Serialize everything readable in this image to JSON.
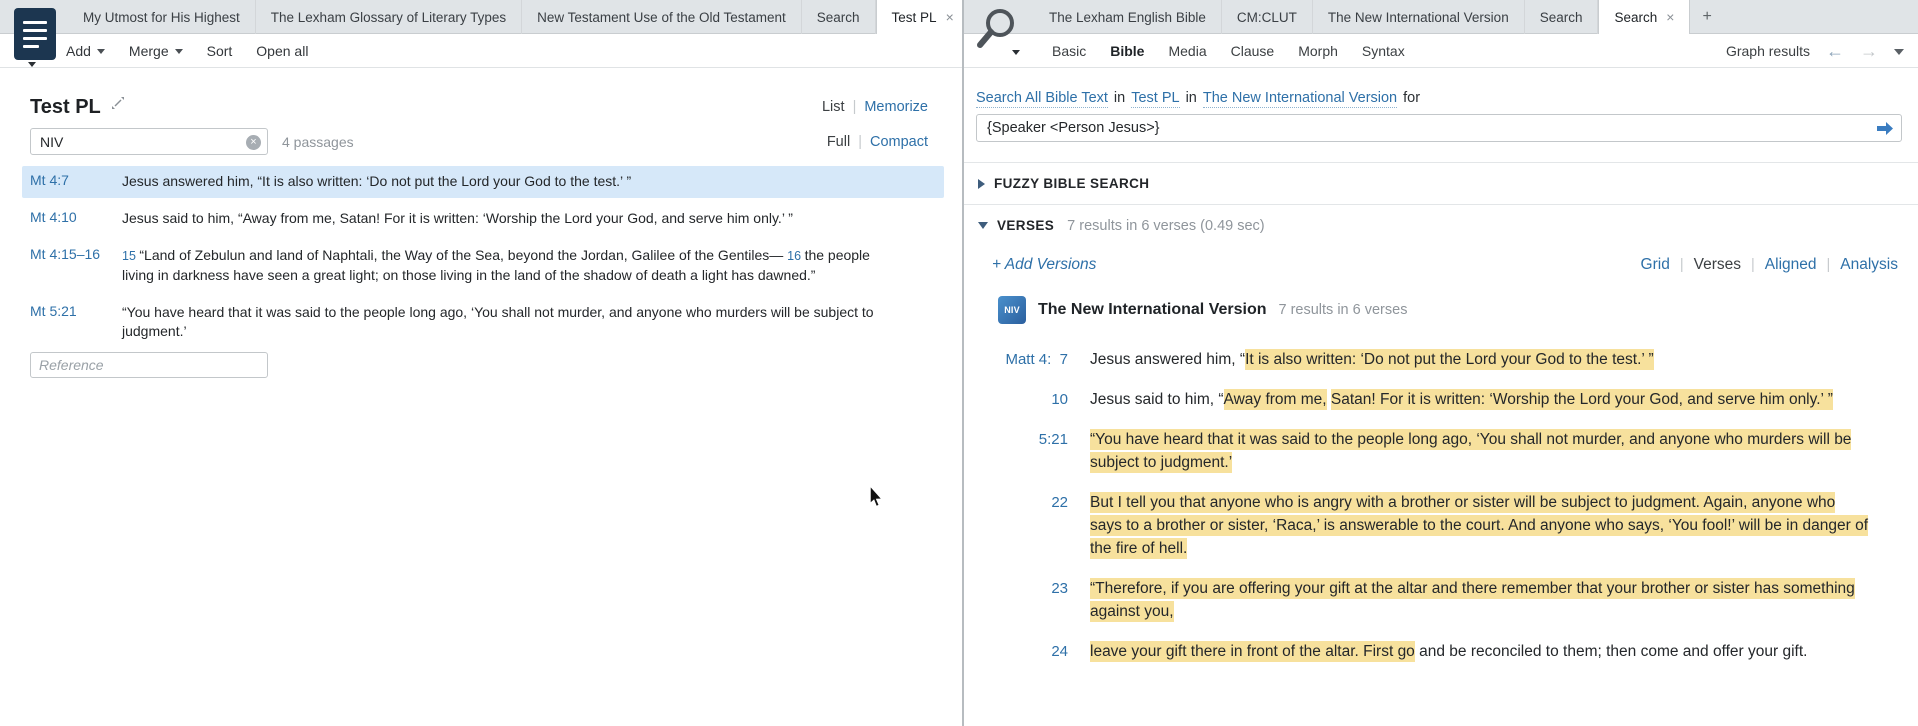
{
  "left": {
    "tabs": [
      {
        "label": "My Utmost for His Highest"
      },
      {
        "label": "The Lexham Glossary of Literary Types"
      },
      {
        "label": "New Testament Use of the Old Testament"
      },
      {
        "label": "Search"
      },
      {
        "label": "Test PL",
        "active": true,
        "closable": true
      },
      {
        "label": "+",
        "add": true
      }
    ],
    "toolbar": [
      {
        "label": "Add",
        "caret": true
      },
      {
        "label": "Merge",
        "caret": true
      },
      {
        "label": "Sort"
      },
      {
        "label": "Open all"
      }
    ],
    "title": "Test PL",
    "view_toggle": [
      {
        "label": "List",
        "active": true
      },
      {
        "label": "Memorize"
      }
    ],
    "filter_value": "NIV",
    "passage_count": "4 passages",
    "density_toggle": [
      {
        "label": "Full",
        "active": true
      },
      {
        "label": "Compact"
      }
    ],
    "passages": [
      {
        "ref": "Mt 4:7",
        "selected": true,
        "segments": [
          {
            "text": "Jesus answered him, “It is also written: ‘Do not put the Lord your God to the test.’ ”"
          }
        ]
      },
      {
        "ref": "Mt 4:10",
        "segments": [
          {
            "text": "Jesus said to him, “Away from me, Satan! For it is written: ‘Worship the Lord your God, and serve him only.’ ”"
          }
        ]
      },
      {
        "ref": "Mt 4:15–16",
        "segments": [
          {
            "verse_num": "15"
          },
          {
            "text": "“Land of Zebulun and land of Naphtali, the Way of the Sea, beyond the Jordan, Galilee of the Gentiles— "
          },
          {
            "verse_num": "16"
          },
          {
            "text": "the people living in darkness have seen a great light; on those living in the land of the shadow of death a light has dawned.”"
          }
        ]
      },
      {
        "ref": "Mt 5:21",
        "segments": [
          {
            "text": "“You have heard that it was said to the people long ago, ‘You shall not murder, and anyone who murders will be subject to judgment.’"
          }
        ]
      }
    ],
    "reference_placeholder": "Reference"
  },
  "right": {
    "tabs": [
      {
        "label": "The Lexham English Bible"
      },
      {
        "label": "CM:CLUT"
      },
      {
        "label": "The New International Version"
      },
      {
        "label": "Search"
      },
      {
        "label": "Search",
        "active": true,
        "closable": true
      },
      {
        "label": "+",
        "add": true
      }
    ],
    "search_kinds": [
      {
        "label": "Basic"
      },
      {
        "label": "Bible",
        "active": true
      },
      {
        "label": "Media"
      },
      {
        "label": "Clause"
      },
      {
        "label": "Morph"
      },
      {
        "label": "Syntax"
      }
    ],
    "graph_results": "Graph results",
    "scope": [
      {
        "text": "Search All Bible Text",
        "link": true
      },
      {
        "text": "in"
      },
      {
        "text": "Test PL",
        "link": true
      },
      {
        "text": "in"
      },
      {
        "text": "The New International Version",
        "link": true
      },
      {
        "text": "for"
      }
    ],
    "query": "{Speaker <Person Jesus>}",
    "fuzzy_section": "FUZZY BIBLE SEARCH",
    "verses_section": "VERSES",
    "verses_stats": "7 results in 6 verses (0.49 sec)",
    "add_versions": "+ Add Versions",
    "result_views": [
      {
        "label": "Grid"
      },
      {
        "label": "Verses",
        "active": true
      },
      {
        "label": "Aligned"
      },
      {
        "label": "Analysis"
      }
    ],
    "resource": {
      "abbr": "NIV",
      "name": "The New International Version",
      "stats": "7 results in 6 verses"
    },
    "results": [
      {
        "ref": "Matt 4:  7",
        "segments": [
          {
            "text": "Jesus answered him, “"
          },
          {
            "text": "It is also written: ‘Do not put the Lord your God to the test.’ ”",
            "hl": true
          }
        ]
      },
      {
        "ref": "10",
        "segments": [
          {
            "text": "Jesus said to him, “"
          },
          {
            "text": "Away from me,",
            "hl": true
          },
          {
            "text": " "
          },
          {
            "text": "Satan! For it is written: ‘Worship the Lord your God, and serve him only.’ ”",
            "hl": true
          }
        ]
      },
      {
        "ref": "5:21",
        "segments": [
          {
            "text": "“You have heard that it was said to the people long ago, ‘You shall not murder, and anyone who murders will be subject to judgment.’",
            "hl": true
          }
        ]
      },
      {
        "ref": "22",
        "segments": [
          {
            "text": "But I tell you that anyone who is angry with a brother or sister will be subject to judgment. Again, anyone who says to a brother or sister, ‘Raca,’ is answerable to the court. And anyone who says, ‘You fool!’ will be in danger of the fire of hell.",
            "hl": true
          }
        ]
      },
      {
        "ref": "23",
        "segments": [
          {
            "text": "“Therefore, if you are offering your gift at the altar and there remember that your brother or sister has something against you,",
            "hl": true
          }
        ]
      },
      {
        "ref": "24",
        "segments": [
          {
            "text": "leave your gift there in front of the altar. First go",
            "hl": true
          },
          {
            "text": " and be reconciled to them; then come and offer your gift."
          }
        ]
      }
    ]
  },
  "colors": {
    "link": "#2e70a8",
    "highlight": "#f7e19d",
    "selected_row": "#d6e8f9",
    "panel_menu": "#1c3650"
  }
}
